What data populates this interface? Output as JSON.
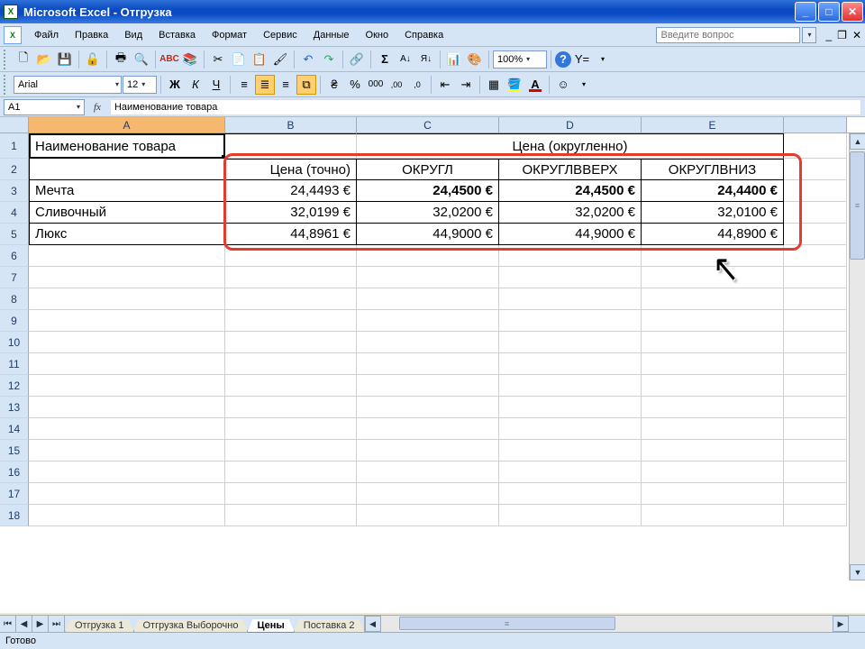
{
  "title": "Microsoft Excel - Отгрузка",
  "menus": {
    "file": "Файл",
    "edit": "Правка",
    "view": "Вид",
    "insert": "Вставка",
    "format": "Формат",
    "tools": "Сервис",
    "data": "Данные",
    "window": "Окно",
    "help": "Справка"
  },
  "help_placeholder": "Введите вопрос",
  "toolbar": {
    "font": "Arial",
    "font_size": "12",
    "zoom": "100%"
  },
  "namebox": "A1",
  "formula": "Наименование товара",
  "columns": [
    "A",
    "B",
    "C",
    "D",
    "E"
  ],
  "merged_header": "Цена (округленно)",
  "grid": {
    "row1": {
      "a": "Наименование товара"
    },
    "row2": {
      "b": "Цена (точно)",
      "c": "ОКРУГЛ",
      "d": "ОКРУГЛВВЕРХ",
      "e": "ОКРУГЛВНИЗ"
    },
    "row3": {
      "a": "Мечта",
      "b": "24,4493 €",
      "c": "24,4500 €",
      "d": "24,4500 €",
      "e": "24,4400 €"
    },
    "row4": {
      "a": "Сливочный",
      "b": "32,0199 €",
      "c": "32,0200 €",
      "d": "32,0200 €",
      "e": "32,0100 €"
    },
    "row5": {
      "a": "Люкс",
      "b": "44,8961 €",
      "c": "44,9000 €",
      "d": "44,9000 €",
      "e": "44,8900 €"
    }
  },
  "empty_rows": [
    "6",
    "7",
    "8",
    "9",
    "10",
    "11",
    "12",
    "13",
    "14",
    "15",
    "16",
    "17",
    "18"
  ],
  "sheets": {
    "s1": "Отгрузка 1",
    "s2": "Отгрузка Выборочно",
    "s3": "Цены",
    "s4": "Поставка 2"
  },
  "status": "Готово"
}
